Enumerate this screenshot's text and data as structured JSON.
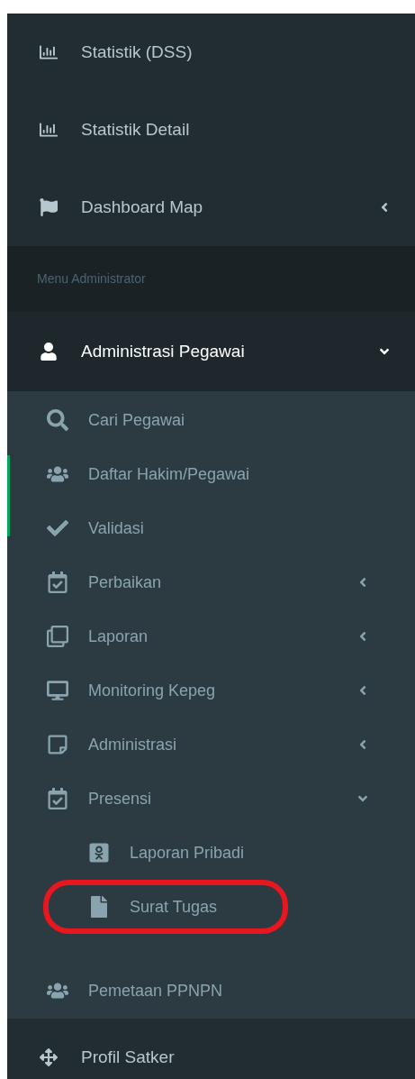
{
  "top_items": [
    {
      "label": "Statistik (DSS)",
      "kind": "chart"
    },
    {
      "label": "Statistik Detail",
      "kind": "chart"
    },
    {
      "label": "Dashboard Map",
      "kind": "flag",
      "expanded": false
    }
  ],
  "section_header": "Menu Administrator",
  "admin_menu": {
    "label": "Administrasi Pegawai",
    "kind": "user",
    "expanded": true,
    "children": [
      {
        "label": "Cari Pegawai",
        "kind": "search"
      },
      {
        "label": "Daftar Hakim/Pegawai",
        "kind": "users"
      },
      {
        "label": "Validasi",
        "kind": "check"
      },
      {
        "label": "Perbaikan",
        "kind": "calendar",
        "expanded": false
      },
      {
        "label": "Laporan",
        "kind": "clone",
        "expanded": false
      },
      {
        "label": "Monitoring Kepeg",
        "kind": "desktop",
        "expanded": false
      },
      {
        "label": "Administrasi",
        "kind": "note",
        "expanded": false
      },
      {
        "label": "Presensi",
        "kind": "calendar",
        "expanded": true,
        "children": [
          {
            "label": "Laporan Pribadi",
            "kind": "badge",
            "highlighted": false
          },
          {
            "label": "Surat Tugas",
            "kind": "file",
            "highlighted": true
          }
        ]
      },
      {
        "label": "Pemetaan PPNPN",
        "kind": "users"
      }
    ]
  },
  "bottom_items": [
    {
      "label": "Profil Satker",
      "kind": "move"
    }
  ]
}
